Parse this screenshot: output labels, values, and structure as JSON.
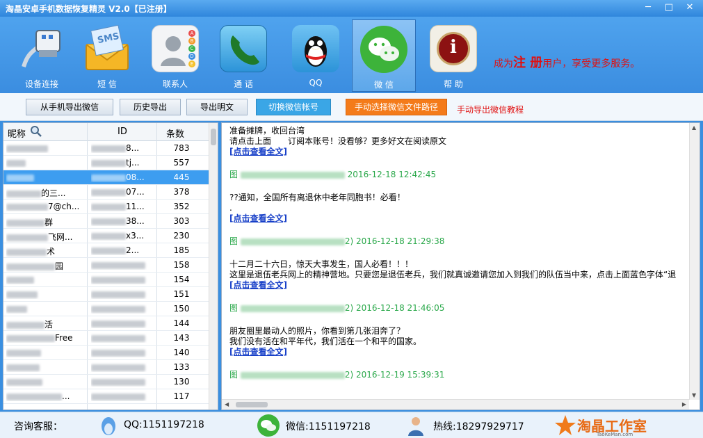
{
  "app": {
    "title": "淘晶安卓手机数据恢复精灵 V2.0【已注册】"
  },
  "window": {
    "minimize": "─",
    "maximize": "□",
    "close": "✕"
  },
  "toolbar": {
    "items": [
      {
        "label": "设备连接"
      },
      {
        "label": "短 信",
        "icon_text": "SMS"
      },
      {
        "label": "联系人",
        "icon_letters": [
          "A",
          "B",
          "C",
          "D",
          "E"
        ]
      },
      {
        "label": "通 话"
      },
      {
        "label": "QQ"
      },
      {
        "label": "微 信"
      },
      {
        "label": "帮 助",
        "icon_text": "i"
      }
    ],
    "promo_pre": "成为",
    "promo_big": "注 册",
    "promo_post": "用户，享受更多服务。",
    "active_color": "#5da7ea"
  },
  "actions": {
    "export_from_phone": "从手机导出微信",
    "history_export": "历史导出",
    "export_plain": "导出明文",
    "switch_account": "切换微信帐号",
    "manual_path": "手动选择微信文件路径",
    "tutorial_link": "手动导出微信教程"
  },
  "list": {
    "headers": {
      "nick": "昵称",
      "id": "ID",
      "count": "条数"
    },
    "rows": [
      {
        "nick": "",
        "id": "8...",
        "count": "783"
      },
      {
        "nick": "",
        "id": "tj...",
        "count": "557"
      },
      {
        "nick": "",
        "id": "08...",
        "count": "445",
        "selected": true
      },
      {
        "nick": "的三...",
        "id": "07...",
        "count": "378"
      },
      {
        "nick": "7@ch...",
        "id": "11...",
        "count": "352"
      },
      {
        "nick": "群",
        "id": "38...",
        "count": "303"
      },
      {
        "nick": "飞网...",
        "id": "x3...",
        "count": "230"
      },
      {
        "nick": "术",
        "id": "2...",
        "count": "185"
      },
      {
        "nick": "园",
        "id": "",
        "count": "158"
      },
      {
        "nick": "",
        "id": "",
        "count": "154"
      },
      {
        "nick": "",
        "id": "",
        "count": "151"
      },
      {
        "nick": "",
        "id": "",
        "count": "150"
      },
      {
        "nick": "活",
        "id": "",
        "count": "144"
      },
      {
        "nick": "Free",
        "id": "",
        "count": "143"
      },
      {
        "nick": "",
        "id": "",
        "count": "140"
      },
      {
        "nick": "",
        "id": "",
        "count": "133"
      },
      {
        "nick": "",
        "id": "",
        "count": "130"
      },
      {
        "nick": "...",
        "id": "",
        "count": "117"
      }
    ]
  },
  "messages": {
    "intro_1": "准备摊牌，收回台湾",
    "intro_2": "请点击上面　　订阅本账号！没看够？更多好文在阅读原文",
    "link": "[点击查看全文]",
    "items": [
      {
        "meta_prefix": "图",
        "meta_suffix": "2016-12-18 12:42:45",
        "lines": [
          "??通知，全国所有离退休中老年同胞书！必看！",
          "."
        ]
      },
      {
        "meta_prefix": "图",
        "meta_suffix": "2) 2016-12-18 21:29:38",
        "lines": [
          "十二月二十六日，惊天大事发生，国人必看！！！",
          "这里是退伍老兵网上的精神营地。只要您是退伍老兵，我们就真诚邀请您加入到我们的队伍当中来，点击上面蓝色字体“退"
        ]
      },
      {
        "meta_prefix": "图",
        "meta_suffix": "2) 2016-12-18 21:46:05",
        "lines": [
          "朋友圈里最动人的照片，你看到第几张泪奔了？",
          "我们没有活在和平年代，我们活在一个和平的国家。"
        ]
      },
      {
        "meta_prefix": "图",
        "meta_suffix": "2) 2016-12-19 15:39:31",
        "lines": []
      }
    ]
  },
  "status": {
    "consult": "咨询客服：",
    "qq": "QQ:1151197218",
    "wechat": "微信:1151197218",
    "hotline": "热线:18297929717",
    "logo_text": "淘晶工作室",
    "logo_sub": "TaoKeMan.com"
  }
}
